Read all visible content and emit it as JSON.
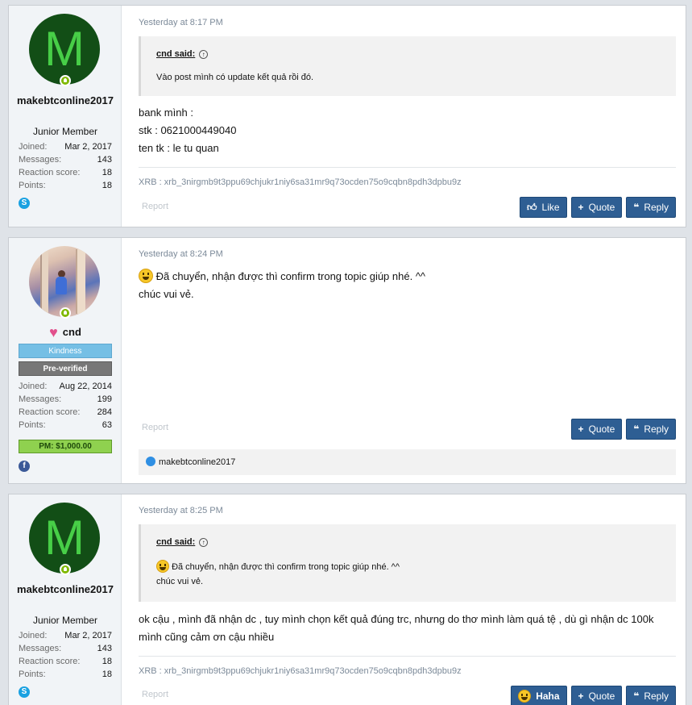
{
  "posts": [
    {
      "user": {
        "avatar_letter": "M",
        "name": "makebtconline2017",
        "title": "Junior Member",
        "stats": [
          {
            "k": "Joined:",
            "v": "Mar 2, 2017"
          },
          {
            "k": "Messages:",
            "v": "143"
          },
          {
            "k": "Reaction score:",
            "v": "18"
          },
          {
            "k": "Points:",
            "v": "18"
          }
        ],
        "social_icon": "skype-icon"
      },
      "date": "Yesterday at 8:17 PM",
      "quote": {
        "author": "cnd said:",
        "text": "Vào post mình có update kết quả rồi đó."
      },
      "body": [
        "bank mình :",
        "stk : 0621000449040",
        "ten tk : le tu quan"
      ],
      "signature": "XRB : xrb_3nirgmb9t3ppu69chjukr1niy6sa31mr9q73ocden75o9cqbn8pdh3dpbu9z",
      "report": "Report",
      "buttons": {
        "like": "Like",
        "quote": "Quote",
        "reply": "Reply"
      }
    },
    {
      "user": {
        "name": "cnd",
        "banner1": "Kindness",
        "banner2": "Pre-verified",
        "stats": [
          {
            "k": "Joined:",
            "v": "Aug 22, 2014"
          },
          {
            "k": "Messages:",
            "v": "199"
          },
          {
            "k": "Reaction score:",
            "v": "284"
          },
          {
            "k": "Points:",
            "v": "63"
          }
        ],
        "pm_banner": "PM: $1,000.00",
        "social_icon": "facebook-icon"
      },
      "date": "Yesterday at 8:24 PM",
      "body": [
        "Đã chuyển, nhận được thì confirm trong topic giúp nhé. ^^",
        "chúc vui vẻ."
      ],
      "report": "Report",
      "buttons": {
        "quote": "Quote",
        "reply": "Reply"
      },
      "reactions": "makebtconline2017"
    },
    {
      "user": {
        "avatar_letter": "M",
        "name": "makebtconline2017",
        "title": "Junior Member",
        "stats": [
          {
            "k": "Joined:",
            "v": "Mar 2, 2017"
          },
          {
            "k": "Messages:",
            "v": "143"
          },
          {
            "k": "Reaction score:",
            "v": "18"
          },
          {
            "k": "Points:",
            "v": "18"
          }
        ],
        "social_icon": "skype-icon"
      },
      "date": "Yesterday at 8:25 PM",
      "quote": {
        "author": "cnd said:",
        "text1": "Đã chuyển, nhận được thì confirm trong topic giúp nhé. ^^",
        "text2": "chúc vui vẻ."
      },
      "body": [
        "ok cậu , mình đã nhận dc , tuy mình chọn kết quả đúng trc, nhưng do thơ mình làm quá tệ , dù gì nhận dc 100k",
        "mình cũng cảm ơn cậu nhiều"
      ],
      "signature": "XRB : xrb_3nirgmb9t3ppu69chjukr1niy6sa31mr9q73ocden75o9cqbn8pdh3dpbu9z",
      "report": "Report",
      "buttons": {
        "haha": "Haha",
        "quote": "Quote",
        "reply": "Reply"
      }
    }
  ],
  "colors": {
    "button": "#2e5e93",
    "avatar_bg": "#124e16",
    "avatar_letter": "#47ce47",
    "online": "#7fb900"
  }
}
